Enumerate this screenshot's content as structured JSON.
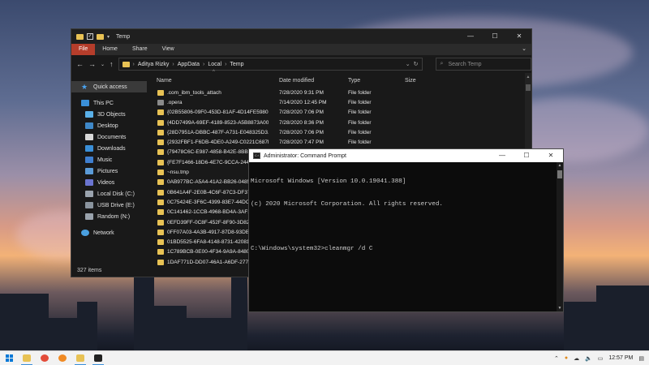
{
  "explorer": {
    "title": "Temp",
    "window_controls": [
      "—",
      "☐",
      "✕"
    ],
    "ribbon_tabs": [
      "File",
      "Home",
      "Share",
      "View"
    ],
    "address_path": [
      "Aditya Rizky",
      "AppData",
      "Local",
      "Temp"
    ],
    "search_placeholder": "Search Temp",
    "columns": [
      "Name",
      "Date modified",
      "Type",
      "Size"
    ],
    "nav_items": [
      {
        "label": "Quick access",
        "icon": "star-icon"
      },
      {
        "label": "This PC",
        "icon": "pc-icon"
      },
      {
        "label": "3D Objects",
        "icon": "3d-objects-icon"
      },
      {
        "label": "Desktop",
        "icon": "desktop-icon"
      },
      {
        "label": "Documents",
        "icon": "documents-icon"
      },
      {
        "label": "Downloads",
        "icon": "downloads-icon"
      },
      {
        "label": "Music",
        "icon": "music-icon"
      },
      {
        "label": "Pictures",
        "icon": "pictures-icon"
      },
      {
        "label": "Videos",
        "icon": "videos-icon"
      },
      {
        "label": "Local Disk (C:)",
        "icon": "drive-icon"
      },
      {
        "label": "USB Drive (E:)",
        "icon": "usb-drive-icon"
      },
      {
        "label": "Random (N:)",
        "icon": "drive-icon"
      },
      {
        "label": "Network",
        "icon": "network-icon"
      }
    ],
    "files": [
      {
        "name": ".com_ibm_tools_attach",
        "date": "7/28/2020 9:31 PM",
        "type": "File folder"
      },
      {
        "name": ".opera",
        "date": "7/14/2020 12:45 PM",
        "type": "File folder"
      },
      {
        "name": "{02B55806-09F0-453D-81AF-4D14FE5980...",
        "date": "7/28/2020 7:06 PM",
        "type": "File folder"
      },
      {
        "name": "{4DD7499A-69EF-4189-8523-A5B8873A00...",
        "date": "7/28/2020 8:36 PM",
        "type": "File folder"
      },
      {
        "name": "{28D7951A-DBBC-487F-A731-E048325D3...",
        "date": "7/28/2020 7:06 PM",
        "type": "File folder"
      },
      {
        "name": "{2932FBF1-F6DB-4DE0-A249-C0221C687E...",
        "date": "7/28/2020 7:47 PM",
        "type": "File folder"
      },
      {
        "name": "{79478C6C-E987-4858-B42E-8BB3",
        "date": "",
        "type": ""
      },
      {
        "name": "{FE7F1466-18D6-4E7C-9CCA-2446",
        "date": "",
        "type": ""
      },
      {
        "name": "~nsu.tmp",
        "date": "",
        "type": ""
      },
      {
        "name": "0AB977BC-A5A4-41A2-BB26-0485",
        "date": "",
        "type": ""
      },
      {
        "name": "0B641A4F-2E0B-4C6F-87C3-DF37",
        "date": "",
        "type": ""
      },
      {
        "name": "0C75424E-3F6C-4399-83E7-44DC",
        "date": "",
        "type": ""
      },
      {
        "name": "0C141462-1CCB-4968-BD4A-3AF2",
        "date": "",
        "type": ""
      },
      {
        "name": "0EFD39FF-0C8F-452F-8F90-3D820",
        "date": "",
        "type": ""
      },
      {
        "name": "0FF07A03-4A3B-4917-87D8-93DB",
        "date": "",
        "type": ""
      },
      {
        "name": "01BD5525-6FA8-4148-8731-420812",
        "date": "",
        "type": ""
      },
      {
        "name": "1C789BCB-0E00-4F34-9A9A-8480",
        "date": "",
        "type": ""
      },
      {
        "name": "1DAF771D-DD07-46A1-A6DF-277",
        "date": "",
        "type": ""
      }
    ],
    "status": "327 items"
  },
  "cmd": {
    "title": "Administrator: Command Prompt",
    "window_controls": [
      "—",
      "☐",
      "✕"
    ],
    "lines": [
      "Microsoft Windows [Version 10.0.19041.388]",
      "(c) 2020 Microsoft Corporation. All rights reserved.",
      "",
      "C:\\Windows\\system32>cleanmgr /d C"
    ]
  },
  "taskbar": {
    "clock": "12:57 PM",
    "apps": [
      {
        "name": "file-explorer-icon",
        "color": "#e8c254",
        "active": true
      },
      {
        "name": "chrome-icon",
        "color": "#e34c3a",
        "active": false
      },
      {
        "name": "firefox-icon",
        "color": "#f08a24",
        "active": false
      },
      {
        "name": "folder-icon",
        "color": "#e8c254",
        "active": true
      },
      {
        "name": "cmd-icon",
        "color": "#222222",
        "active": true
      }
    ]
  },
  "colors": {
    "file_tab": "#b53d2b",
    "folder": "#e8c254",
    "accent": "#0078d7"
  }
}
